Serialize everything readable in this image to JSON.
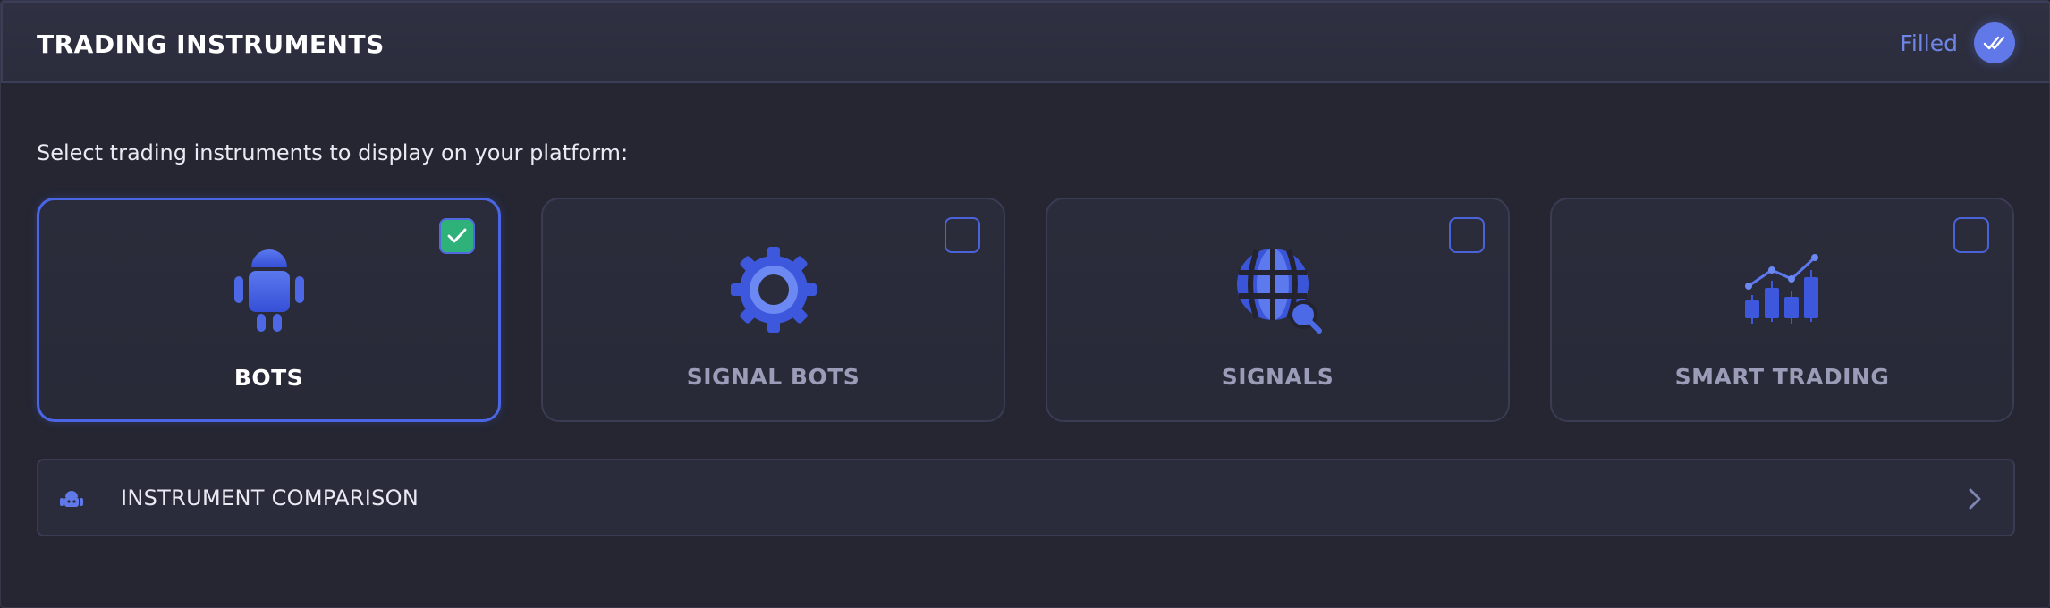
{
  "header": {
    "title": "TRADING INSTRUMENTS",
    "status_text": "Filled",
    "status_icon": "double-check-icon"
  },
  "instructions": "Select trading instruments to display on your platform:",
  "instruments": [
    {
      "label": "BOTS",
      "icon": "robot-icon",
      "selected": true
    },
    {
      "label": "SIGNAL BOTS",
      "icon": "gear-icon",
      "selected": false
    },
    {
      "label": "SIGNALS",
      "icon": "globe-search-icon",
      "selected": false
    },
    {
      "label": "SMART TRADING",
      "icon": "candlestick-chart-icon",
      "selected": false
    }
  ],
  "comparison": {
    "label": "INSTRUMENT COMPARISON",
    "icon": "robot-head-icon",
    "chevron": "chevron-right-icon"
  },
  "colors": {
    "accent": "#4a66e6",
    "check_green": "#2fb27a",
    "background": "#252632",
    "muted_label": "#9a9cb8"
  }
}
